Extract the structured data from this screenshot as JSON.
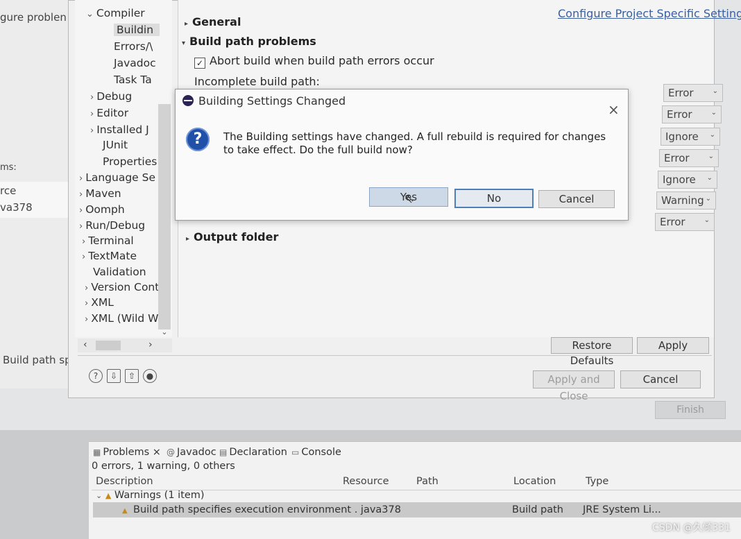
{
  "background": {
    "left_labels": [
      "gure problen",
      "ms:",
      "rce",
      "va378",
      "Build path spec"
    ],
    "finish_label": "Finish"
  },
  "prefs": {
    "tree": [
      {
        "label": "Compiler",
        "chev": "⌄",
        "bold": false
      },
      {
        "label": "Buildin",
        "chev": "",
        "selected": true
      },
      {
        "label": "Errors/\\",
        "chev": ""
      },
      {
        "label": "Javadoc",
        "chev": ""
      },
      {
        "label": "Task Ta",
        "chev": ""
      },
      {
        "label": "Debug",
        "chev": "›"
      },
      {
        "label": "Editor",
        "chev": "›"
      },
      {
        "label": "Installed J",
        "chev": "›"
      },
      {
        "label": "JUnit",
        "chev": ""
      },
      {
        "label": "Properties",
        "chev": ""
      },
      {
        "label": "Language Se",
        "chev": "›"
      },
      {
        "label": "Maven",
        "chev": "›"
      },
      {
        "label": "Oomph",
        "chev": "›"
      },
      {
        "label": "Run/Debug",
        "chev": "›"
      },
      {
        "label": "Terminal",
        "chev": "›"
      },
      {
        "label": "TextMate",
        "chev": "›"
      },
      {
        "label": "Validation",
        "chev": ""
      },
      {
        "label": "Version Cont",
        "chev": "›"
      },
      {
        "label": "XML",
        "chev": "›"
      },
      {
        "label": "XML (Wild W",
        "chev": "›"
      }
    ],
    "config_link": "Configure Project Specific Settings...",
    "sections": {
      "general": "General",
      "build_path_problems": "Build path problems",
      "output_folder": "Output folder"
    },
    "abort_label": "Abort build when build path errors occur",
    "incomplete_label": "Incomplete build path:",
    "combos": [
      "Error",
      "Error",
      "Ignore",
      "Error",
      "Ignore",
      "Warning",
      "Error"
    ],
    "restore_defaults": "Restore Defaults",
    "apply": "Apply",
    "apply_and_close": "Apply and Close",
    "cancel": "Cancel"
  },
  "modal": {
    "title": "Building Settings Changed",
    "message": "The Building settings have changed. A full rebuild is required for changes to take effect. Do the full build now?",
    "yes": "Yes",
    "no": "No",
    "cancel": "Cancel"
  },
  "problems": {
    "tabs": [
      "Problems ×",
      "Javadoc",
      "Declaration",
      "Console"
    ],
    "summary": "0 errors, 1 warning, 0 others",
    "columns": [
      "Description",
      "Resource",
      "Path",
      "Location",
      "Type"
    ],
    "group": "Warnings (1 item)",
    "row": {
      "description": "Build path specifies execution environment . java378",
      "location": "Build path",
      "type": "JRE System Li..."
    }
  },
  "watermark": "CSDN @久倾331"
}
